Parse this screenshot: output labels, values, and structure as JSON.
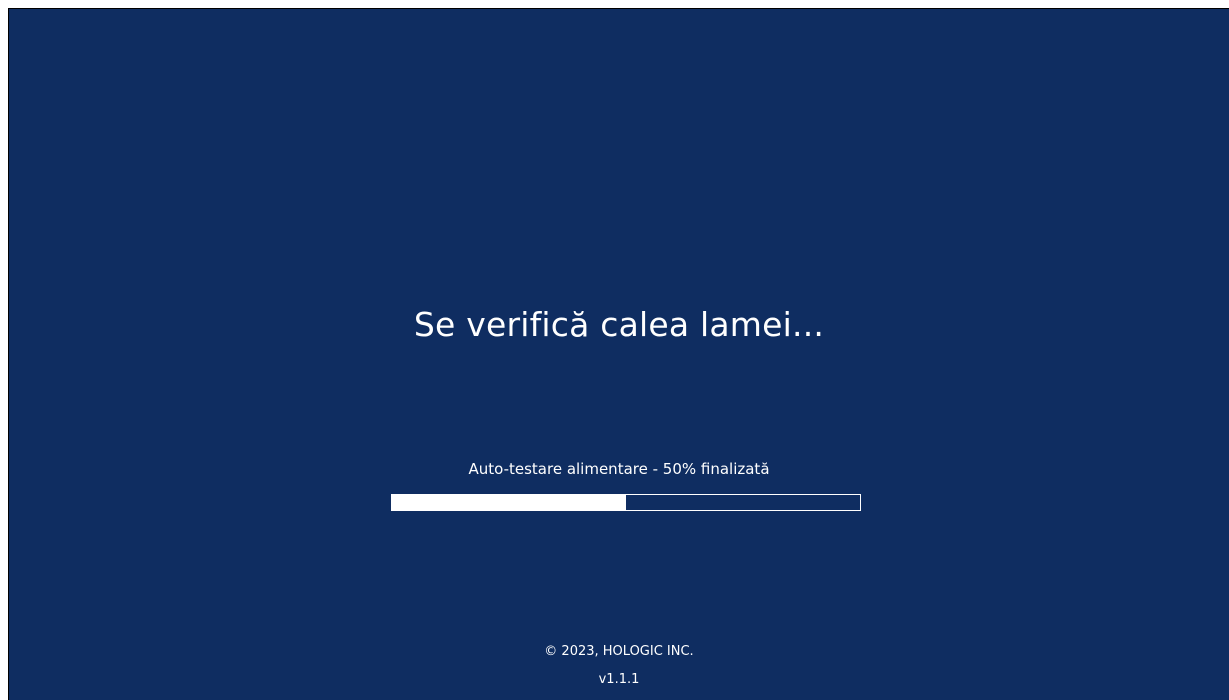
{
  "screen": {
    "background_color": "#0f2d61",
    "status_title": "Se verifică calea lamei...",
    "progress": {
      "label": "Auto-testare alimentare - 50% finalizată",
      "fraction": 0.5
    },
    "footer": {
      "copyright": "© 2023, HOLOGIC INC.",
      "version": "v1.1.1"
    }
  }
}
